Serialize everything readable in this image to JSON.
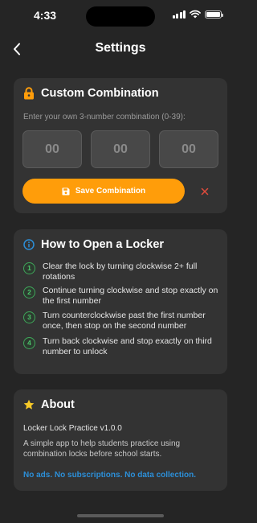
{
  "status_bar": {
    "time": "4:33"
  },
  "nav": {
    "title": "Settings"
  },
  "custom_combination": {
    "title": "Custom Combination",
    "hint": "Enter your own 3-number combination (0-39):",
    "fields": [
      {
        "placeholder": "00"
      },
      {
        "placeholder": "00"
      },
      {
        "placeholder": "00"
      }
    ],
    "save_label": "Save Combination"
  },
  "how_to": {
    "title": "How to Open a Locker",
    "steps": [
      {
        "number": "1",
        "text": "Clear the lock by turning clockwise 2+ full rotations"
      },
      {
        "number": "2",
        "text": "Continue turning clockwise and stop exactly on the first number"
      },
      {
        "number": "3",
        "text": "Turn counterclockwise past the first number once, then stop on the second number"
      },
      {
        "number": "4",
        "text": "Turn back clockwise and stop exactly on third number to unlock"
      }
    ]
  },
  "about": {
    "title": "About",
    "version": "Locker Lock Practice v1.0.0",
    "description": "A simple app to help students practice using combination locks before school starts.",
    "note": "No ads. No subscriptions. No data collection."
  },
  "colors": {
    "accent": "#ff9d0a",
    "danger": "#e14b3c",
    "info": "#2c8fd8",
    "step_green": "#4cc36a"
  },
  "icons": {
    "back": "chevron-left-icon",
    "lock": "lock-icon",
    "info": "info-icon",
    "star": "star-icon",
    "save": "floppy-disk-icon",
    "clear": "close-icon"
  }
}
